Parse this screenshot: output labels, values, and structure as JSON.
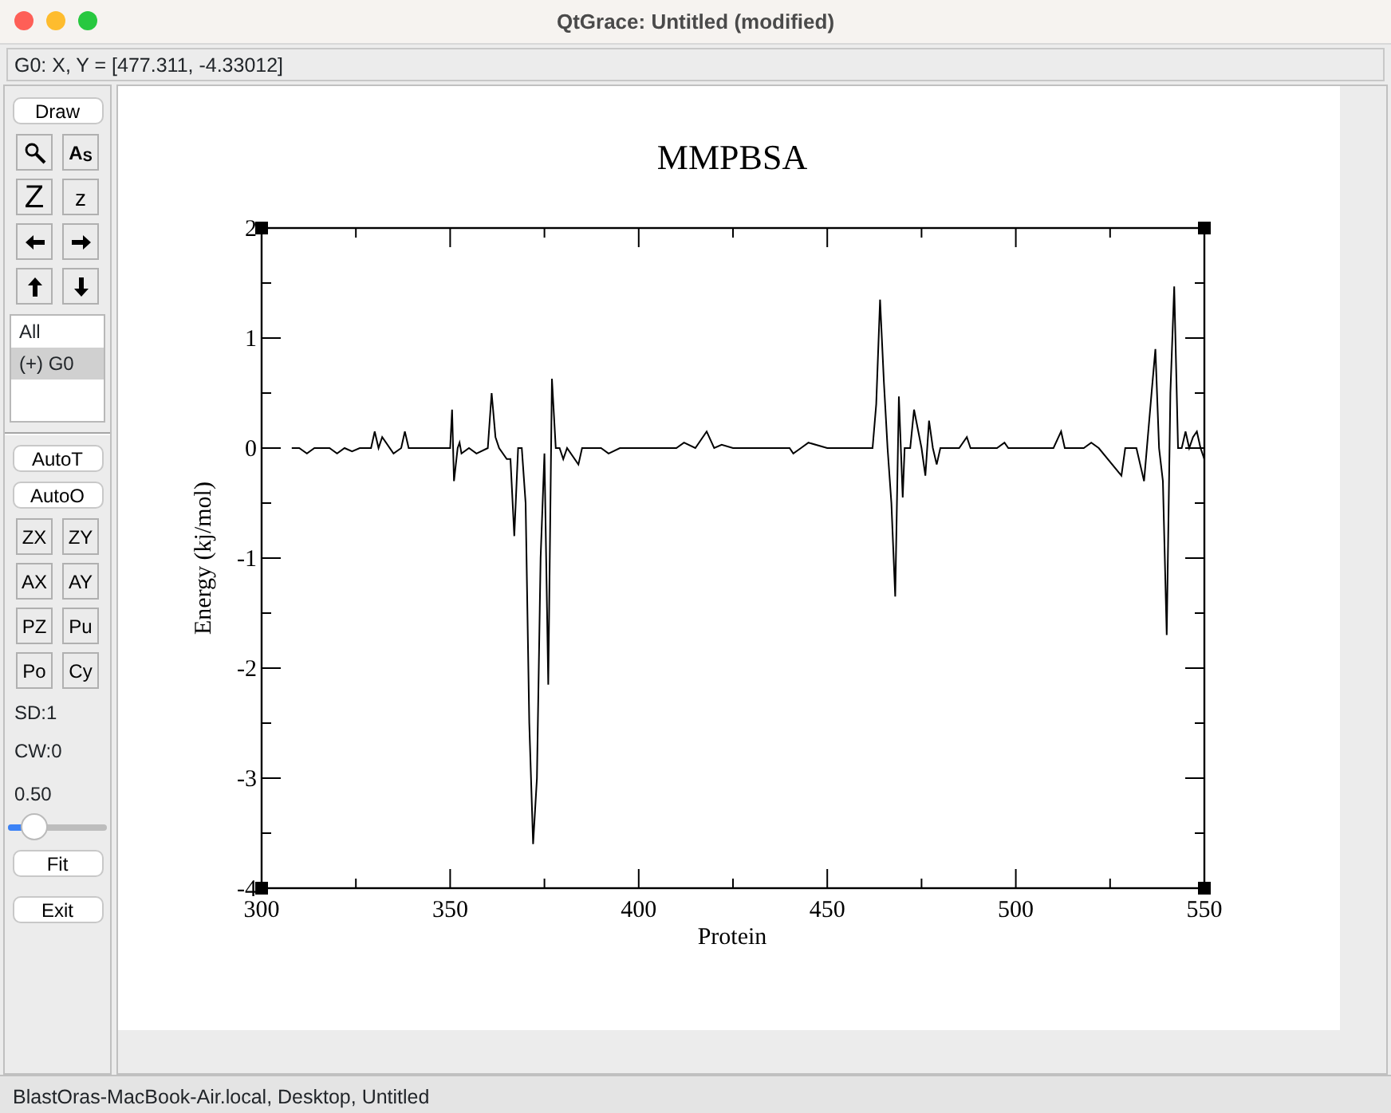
{
  "window": {
    "title": "QtGrace: Untitled (modified)"
  },
  "locator": "G0: X, Y = [477.311, -4.33012]",
  "toolbar": {
    "top_buttons": [
      "Draw"
    ],
    "tools": [
      {
        "kind": "zoom"
      },
      {
        "kind": "glyph",
        "label": "A$_{S}$"
      },
      {
        "kind": "bigglyph",
        "label": "Z"
      },
      {
        "kind": "smallglyph",
        "label": "z"
      },
      {
        "kind": "left"
      },
      {
        "kind": "right"
      },
      {
        "kind": "up"
      },
      {
        "kind": "down"
      }
    ],
    "graphs": [
      {
        "label": "All",
        "selected": false
      },
      {
        "label": "(+) G0",
        "selected": true
      }
    ],
    "auto_buttons": [
      "AutoT",
      "AutoO"
    ],
    "grid_buttons": [
      "ZX",
      "ZY",
      "AX",
      "AY",
      "PZ",
      "Pu",
      "Po",
      "Cy"
    ],
    "readouts": [
      "SD:1",
      "CW:0"
    ],
    "slider": {
      "reading": "0.50",
      "level": 0.25
    },
    "bottom_buttons": [
      "Fit",
      "Exit"
    ]
  },
  "chart_data": {
    "type": "line",
    "title": "MMPBSA",
    "xlabel": "Protein",
    "ylabel": "Energy (kj/mol)",
    "xlim": [
      300,
      550
    ],
    "ylim": [
      -4,
      2
    ],
    "xticks": [
      300,
      350,
      400,
      450,
      500,
      550
    ],
    "yticks": [
      -4,
      -3,
      -2,
      -1,
      0,
      1,
      2
    ],
    "x": [
      308,
      310,
      312,
      314,
      318,
      320,
      322,
      324,
      326,
      329,
      330,
      331,
      332,
      335,
      337,
      338,
      339,
      345,
      348,
      350,
      350.5,
      351,
      352,
      352.5,
      353,
      355,
      357,
      360,
      361,
      362,
      363,
      365,
      366,
      367,
      368,
      369,
      370,
      371,
      372,
      373,
      374,
      375,
      376,
      377,
      378,
      379,
      380,
      381,
      384,
      385,
      390,
      392,
      395,
      400,
      410,
      412,
      415,
      418,
      420,
      422,
      425,
      430,
      440,
      441,
      443,
      445,
      450,
      455,
      460,
      462,
      463,
      464,
      465,
      466,
      467,
      468,
      469,
      470,
      470.5,
      472,
      473,
      475,
      476,
      477,
      478,
      479,
      480,
      485,
      487,
      488,
      495,
      497,
      498,
      510,
      512,
      513,
      518,
      520,
      522,
      528,
      529,
      532,
      534,
      536,
      537,
      538,
      539,
      540,
      541,
      542,
      543,
      544,
      545,
      546,
      547,
      548,
      549,
      550
    ],
    "series": [
      {
        "color": "#000000",
        "values": [
          0,
          0,
          -0.05,
          0,
          0,
          -0.05,
          0,
          -0.03,
          0,
          0,
          0.15,
          0,
          0.1,
          -0.05,
          0,
          0.15,
          0,
          0,
          0,
          0,
          0.35,
          -0.3,
          0,
          0.05,
          -0.05,
          0,
          -0.05,
          0,
          0.5,
          0.1,
          0,
          -0.1,
          -0.1,
          -0.8,
          0,
          0,
          -0.5,
          -2.5,
          -3.6,
          -3,
          -1,
          -0.05,
          -2.15,
          0.63,
          0,
          0,
          -0.1,
          0,
          -0.15,
          0,
          0,
          -0.05,
          0,
          0,
          0,
          0.05,
          0,
          0.15,
          0,
          0.03,
          0,
          0,
          0,
          -0.05,
          0,
          0.05,
          0,
          0,
          0,
          0,
          0.4,
          1.35,
          0.6,
          0,
          -0.5,
          -1.35,
          0.47,
          -0.45,
          0,
          0,
          0.35,
          0,
          -0.25,
          0.25,
          0,
          -0.15,
          0,
          0,
          0.1,
          0,
          0,
          0.05,
          0,
          0,
          0.15,
          0,
          0,
          0.05,
          0,
          -0.25,
          0,
          0,
          -0.3,
          0.5,
          0.9,
          0,
          -0.3,
          -1.7,
          0.5,
          1.47,
          0,
          0,
          0.15,
          0,
          0.1,
          0.15,
          0,
          -0.1
        ]
      }
    ]
  },
  "status_bar": "BlastOras-MacBook-Air.local, Desktop, Untitled"
}
